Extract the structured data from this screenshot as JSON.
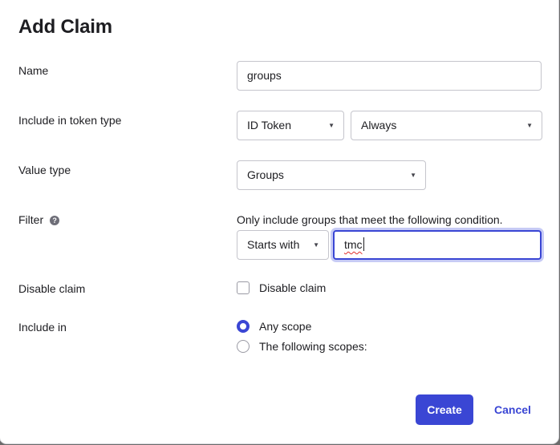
{
  "dialog": {
    "title": "Add Claim"
  },
  "fields": {
    "name": {
      "label": "Name",
      "value": "groups"
    },
    "token_type": {
      "label": "Include in token type",
      "type_value": "ID Token",
      "frequency_value": "Always"
    },
    "value_type": {
      "label": "Value type",
      "value": "Groups"
    },
    "filter": {
      "label": "Filter",
      "help_icon": "question-circle-icon",
      "hint": "Only include groups that meet the following condition.",
      "operator": "Starts with",
      "value": "tmc"
    },
    "disable_claim": {
      "label": "Disable claim",
      "checkbox_label": "Disable claim",
      "checked": false
    },
    "include_in": {
      "label": "Include in",
      "options": [
        {
          "label": "Any scope",
          "selected": true
        },
        {
          "label": "The following scopes:",
          "selected": false
        }
      ]
    }
  },
  "actions": {
    "create_label": "Create",
    "cancel_label": "Cancel"
  },
  "colors": {
    "accent": "#3a46d4",
    "focus_ring": "#c7cbf5",
    "border": "#c5c5cc",
    "text": "#1d1d21",
    "spellcheck": "#e0302c"
  }
}
